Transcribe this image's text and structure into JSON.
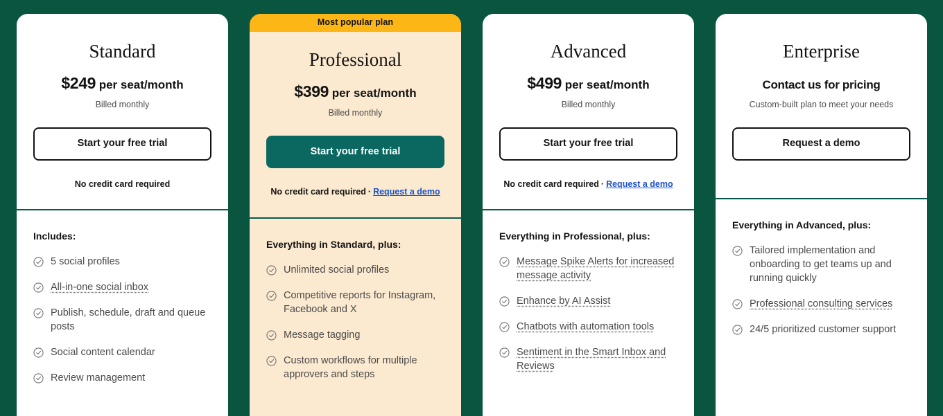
{
  "accent": {
    "page_background": "#0a5540",
    "banner_background": "#fcb716",
    "featured_background": "#fbead0",
    "primary_button": "#0a6860",
    "divider": "#075a4f",
    "link": "#1a52cc"
  },
  "plans": [
    {
      "badge": "",
      "name": "Standard",
      "price_amount": "$249",
      "price_unit": "per seat/month",
      "billing_note": "Billed monthly",
      "cta_label": "Start your free trial",
      "trial_note": "No credit card required",
      "demo_link": "",
      "features_title": "Includes:",
      "features": [
        {
          "text": "5 social profiles",
          "tooltip": false
        },
        {
          "text": "All-in-one social inbox",
          "tooltip": true
        },
        {
          "text": "Publish, schedule, draft and queue posts",
          "tooltip": false
        },
        {
          "text": "Social content calendar",
          "tooltip": false
        },
        {
          "text": "Review management",
          "tooltip": false
        }
      ]
    },
    {
      "badge": "Most popular plan",
      "name": "Professional",
      "price_amount": "$399",
      "price_unit": "per seat/month",
      "billing_note": "Billed monthly",
      "cta_label": "Start your free trial",
      "trial_note": "No credit card required",
      "demo_link": "Request a demo",
      "features_title": "Everything in Standard, plus:",
      "features": [
        {
          "text": "Unlimited social profiles",
          "tooltip": false
        },
        {
          "text": "Competitive reports for Instagram, Facebook and X",
          "tooltip": false
        },
        {
          "text": "Message tagging",
          "tooltip": false
        },
        {
          "text": "Custom workflows for multiple approvers and steps",
          "tooltip": false
        }
      ]
    },
    {
      "badge": "",
      "name": "Advanced",
      "price_amount": "$499",
      "price_unit": "per seat/month",
      "billing_note": "Billed monthly",
      "cta_label": "Start your free trial",
      "trial_note": "No credit card required",
      "demo_link": "Request a demo",
      "features_title": "Everything in Professional, plus:",
      "features": [
        {
          "text": "Message Spike Alerts for increased message activity",
          "tooltip": true
        },
        {
          "text": "Enhance by AI Assist",
          "tooltip": true
        },
        {
          "text": "Chatbots with automation tools",
          "tooltip": true
        },
        {
          "text": "Sentiment in the Smart Inbox and Reviews",
          "tooltip": true
        }
      ]
    },
    {
      "badge": "",
      "name": "Enterprise",
      "price_amount": "",
      "price_unit": "Contact us for pricing",
      "billing_note": "Custom-built plan to meet your needs",
      "cta_label": "Request a demo",
      "trial_note": "",
      "demo_link": "",
      "features_title": "Everything in Advanced, plus:",
      "features": [
        {
          "text": "Tailored implementation and onboarding to get teams up and running quickly",
          "tooltip": false
        },
        {
          "text": "Professional consulting services",
          "tooltip": true
        },
        {
          "text": "24/5 prioritized customer support",
          "tooltip": false
        }
      ]
    }
  ],
  "separator": "·",
  "icons": {
    "check": "check-circle-icon"
  }
}
